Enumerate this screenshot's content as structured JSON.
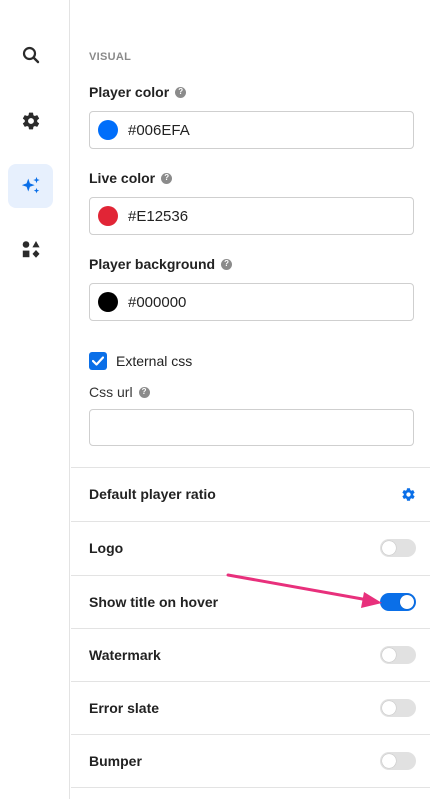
{
  "rail": {
    "items": [
      {
        "icon": "search-icon",
        "active": false
      },
      {
        "icon": "gear-icon",
        "active": false
      },
      {
        "icon": "sparkles-icon",
        "active": true
      },
      {
        "icon": "shapes-icon",
        "active": false
      }
    ]
  },
  "visual": {
    "section_label": "VISUAL",
    "player_color": {
      "label": "Player color",
      "value": "#006EFA",
      "swatch": "#006EFA"
    },
    "live_color": {
      "label": "Live color",
      "value": "#E12536",
      "swatch": "#E12536"
    },
    "player_background": {
      "label": "Player background",
      "value": "#000000",
      "swatch": "#000000"
    },
    "external_css": {
      "label": "External css",
      "checked": true
    },
    "css_url": {
      "label": "Css url",
      "value": "",
      "placeholder": ""
    },
    "help_glyph": "?"
  },
  "settings": [
    {
      "label": "Default player ratio",
      "control": "gear-icon"
    },
    {
      "label": "Logo",
      "control": "toggle",
      "on": false
    },
    {
      "label": "Show title on hover",
      "control": "toggle",
      "on": true
    },
    {
      "label": "Watermark",
      "control": "toggle",
      "on": false
    },
    {
      "label": "Error slate",
      "control": "toggle",
      "on": false
    },
    {
      "label": "Bumper",
      "control": "toggle",
      "on": false
    }
  ],
  "colors": {
    "accent": "#0A6FE8",
    "annotation_arrow": "#E8307C"
  }
}
